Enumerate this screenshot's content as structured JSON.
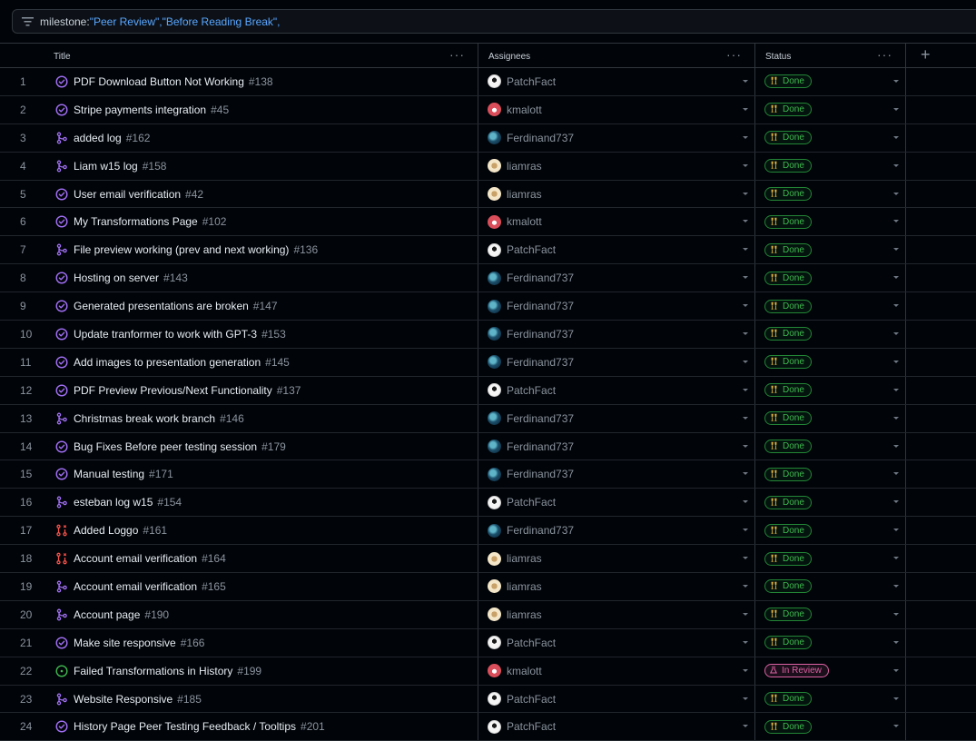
{
  "filter": {
    "key": "milestone:",
    "value": "\"Peer Review\",\"Before Reading Break\","
  },
  "columns": {
    "title": "Title",
    "assignees": "Assignees",
    "status": "Status"
  },
  "icons": {
    "filter": "filter-icon",
    "issue_closed": "issue-closed-icon",
    "pr_merged": "git-merge-icon",
    "pr_closed": "git-pr-closed-icon",
    "issue_open": "issue-open-icon",
    "add_column": "plus-icon"
  },
  "colors": {
    "done": "#3fb950",
    "in_review": "#db61a2",
    "merged": "#a371f7",
    "closed_pr": "#f85149",
    "open": "#3fb950"
  },
  "rows": [
    {
      "n": "1",
      "title": "PDF Download Button Not Working",
      "num": "#138",
      "type": "issue_closed",
      "assignee": "PatchFact",
      "av": "patch",
      "status": "Done"
    },
    {
      "n": "2",
      "title": "Stripe payments integration",
      "num": "#45",
      "type": "issue_closed",
      "assignee": "kmalott",
      "av": "km",
      "status": "Done"
    },
    {
      "n": "3",
      "title": "added log",
      "num": "#162",
      "type": "pr_merged",
      "assignee": "Ferdinand737",
      "av": "ferd",
      "status": "Done"
    },
    {
      "n": "4",
      "title": "Liam w15 log",
      "num": "#158",
      "type": "pr_merged",
      "assignee": "liamras",
      "av": "liam",
      "status": "Done"
    },
    {
      "n": "5",
      "title": "User email verification",
      "num": "#42",
      "type": "issue_closed",
      "assignee": "liamras",
      "av": "liam",
      "status": "Done"
    },
    {
      "n": "6",
      "title": "My Transformations Page",
      "num": "#102",
      "type": "issue_closed",
      "assignee": "kmalott",
      "av": "km",
      "status": "Done"
    },
    {
      "n": "7",
      "title": "File preview working (prev and next working)",
      "num": "#136",
      "type": "pr_merged",
      "assignee": "PatchFact",
      "av": "patch",
      "status": "Done"
    },
    {
      "n": "8",
      "title": "Hosting on server",
      "num": "#143",
      "type": "issue_closed",
      "assignee": "Ferdinand737",
      "av": "ferd",
      "status": "Done"
    },
    {
      "n": "9",
      "title": "Generated presentations are broken",
      "num": "#147",
      "type": "issue_closed",
      "assignee": "Ferdinand737",
      "av": "ferd",
      "status": "Done"
    },
    {
      "n": "10",
      "title": "Update tranformer to work with GPT-3",
      "num": "#153",
      "type": "issue_closed",
      "assignee": "Ferdinand737",
      "av": "ferd",
      "status": "Done"
    },
    {
      "n": "11",
      "title": "Add images to presentation generation",
      "num": "#145",
      "type": "issue_closed",
      "assignee": "Ferdinand737",
      "av": "ferd",
      "status": "Done"
    },
    {
      "n": "12",
      "title": "PDF Preview Previous/Next Functionality",
      "num": "#137",
      "type": "issue_closed",
      "assignee": "PatchFact",
      "av": "patch",
      "status": "Done"
    },
    {
      "n": "13",
      "title": "Christmas break work branch",
      "num": "#146",
      "type": "pr_merged",
      "assignee": "Ferdinand737",
      "av": "ferd",
      "status": "Done"
    },
    {
      "n": "14",
      "title": "Bug Fixes Before peer testing session",
      "num": "#179",
      "type": "issue_closed",
      "assignee": "Ferdinand737",
      "av": "ferd",
      "status": "Done"
    },
    {
      "n": "15",
      "title": "Manual testing",
      "num": "#171",
      "type": "issue_closed",
      "assignee": "Ferdinand737",
      "av": "ferd",
      "status": "Done"
    },
    {
      "n": "16",
      "title": "esteban log w15",
      "num": "#154",
      "type": "pr_merged",
      "assignee": "PatchFact",
      "av": "patch",
      "status": "Done"
    },
    {
      "n": "17",
      "title": "Added Loggo",
      "num": "#161",
      "type": "pr_closed",
      "assignee": "Ferdinand737",
      "av": "ferd",
      "status": "Done"
    },
    {
      "n": "18",
      "title": "Account email verification",
      "num": "#164",
      "type": "pr_closed",
      "assignee": "liamras",
      "av": "liam",
      "status": "Done"
    },
    {
      "n": "19",
      "title": "Account email verification",
      "num": "#165",
      "type": "pr_merged",
      "assignee": "liamras",
      "av": "liam",
      "status": "Done"
    },
    {
      "n": "20",
      "title": "Account page",
      "num": "#190",
      "type": "pr_merged",
      "assignee": "liamras",
      "av": "liam",
      "status": "Done"
    },
    {
      "n": "21",
      "title": "Make site responsive",
      "num": "#166",
      "type": "issue_closed",
      "assignee": "PatchFact",
      "av": "patch",
      "status": "Done"
    },
    {
      "n": "22",
      "title": "Failed Transformations in History",
      "num": "#199",
      "type": "issue_open",
      "assignee": "kmalott",
      "av": "km",
      "status": "In Review"
    },
    {
      "n": "23",
      "title": "Website Responsive",
      "num": "#185",
      "type": "pr_merged",
      "assignee": "PatchFact",
      "av": "patch",
      "status": "Done"
    },
    {
      "n": "24",
      "title": "History Page Peer Testing Feedback / Tooltips",
      "num": "#201",
      "type": "issue_closed",
      "assignee": "PatchFact",
      "av": "patch",
      "status": "Done"
    }
  ]
}
